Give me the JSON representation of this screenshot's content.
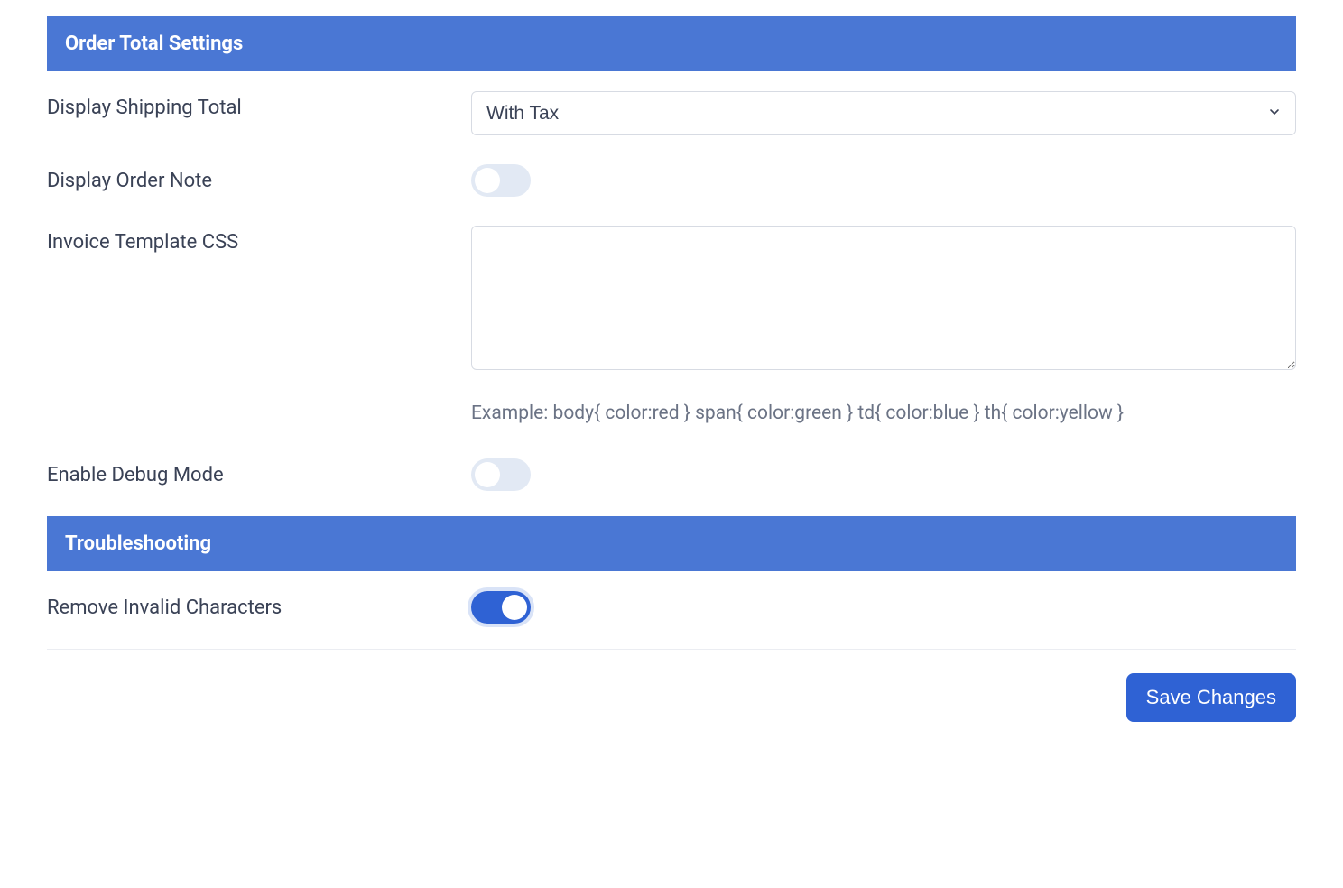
{
  "sections": {
    "order_total": {
      "title": "Order Total Settings",
      "display_shipping_total": {
        "label": "Display Shipping Total",
        "value": "With Tax"
      },
      "display_order_note": {
        "label": "Display Order Note",
        "checked": false
      },
      "invoice_template_css": {
        "label": "Invoice Template CSS",
        "value": "",
        "help": "Example: body{ color:red } span{ color:green } td{ color:blue } th{ color:yellow }"
      },
      "enable_debug_mode": {
        "label": "Enable Debug Mode",
        "checked": false
      }
    },
    "troubleshooting": {
      "title": "Troubleshooting",
      "remove_invalid_characters": {
        "label": "Remove Invalid Characters",
        "checked": true
      }
    }
  },
  "actions": {
    "save_label": "Save Changes"
  }
}
